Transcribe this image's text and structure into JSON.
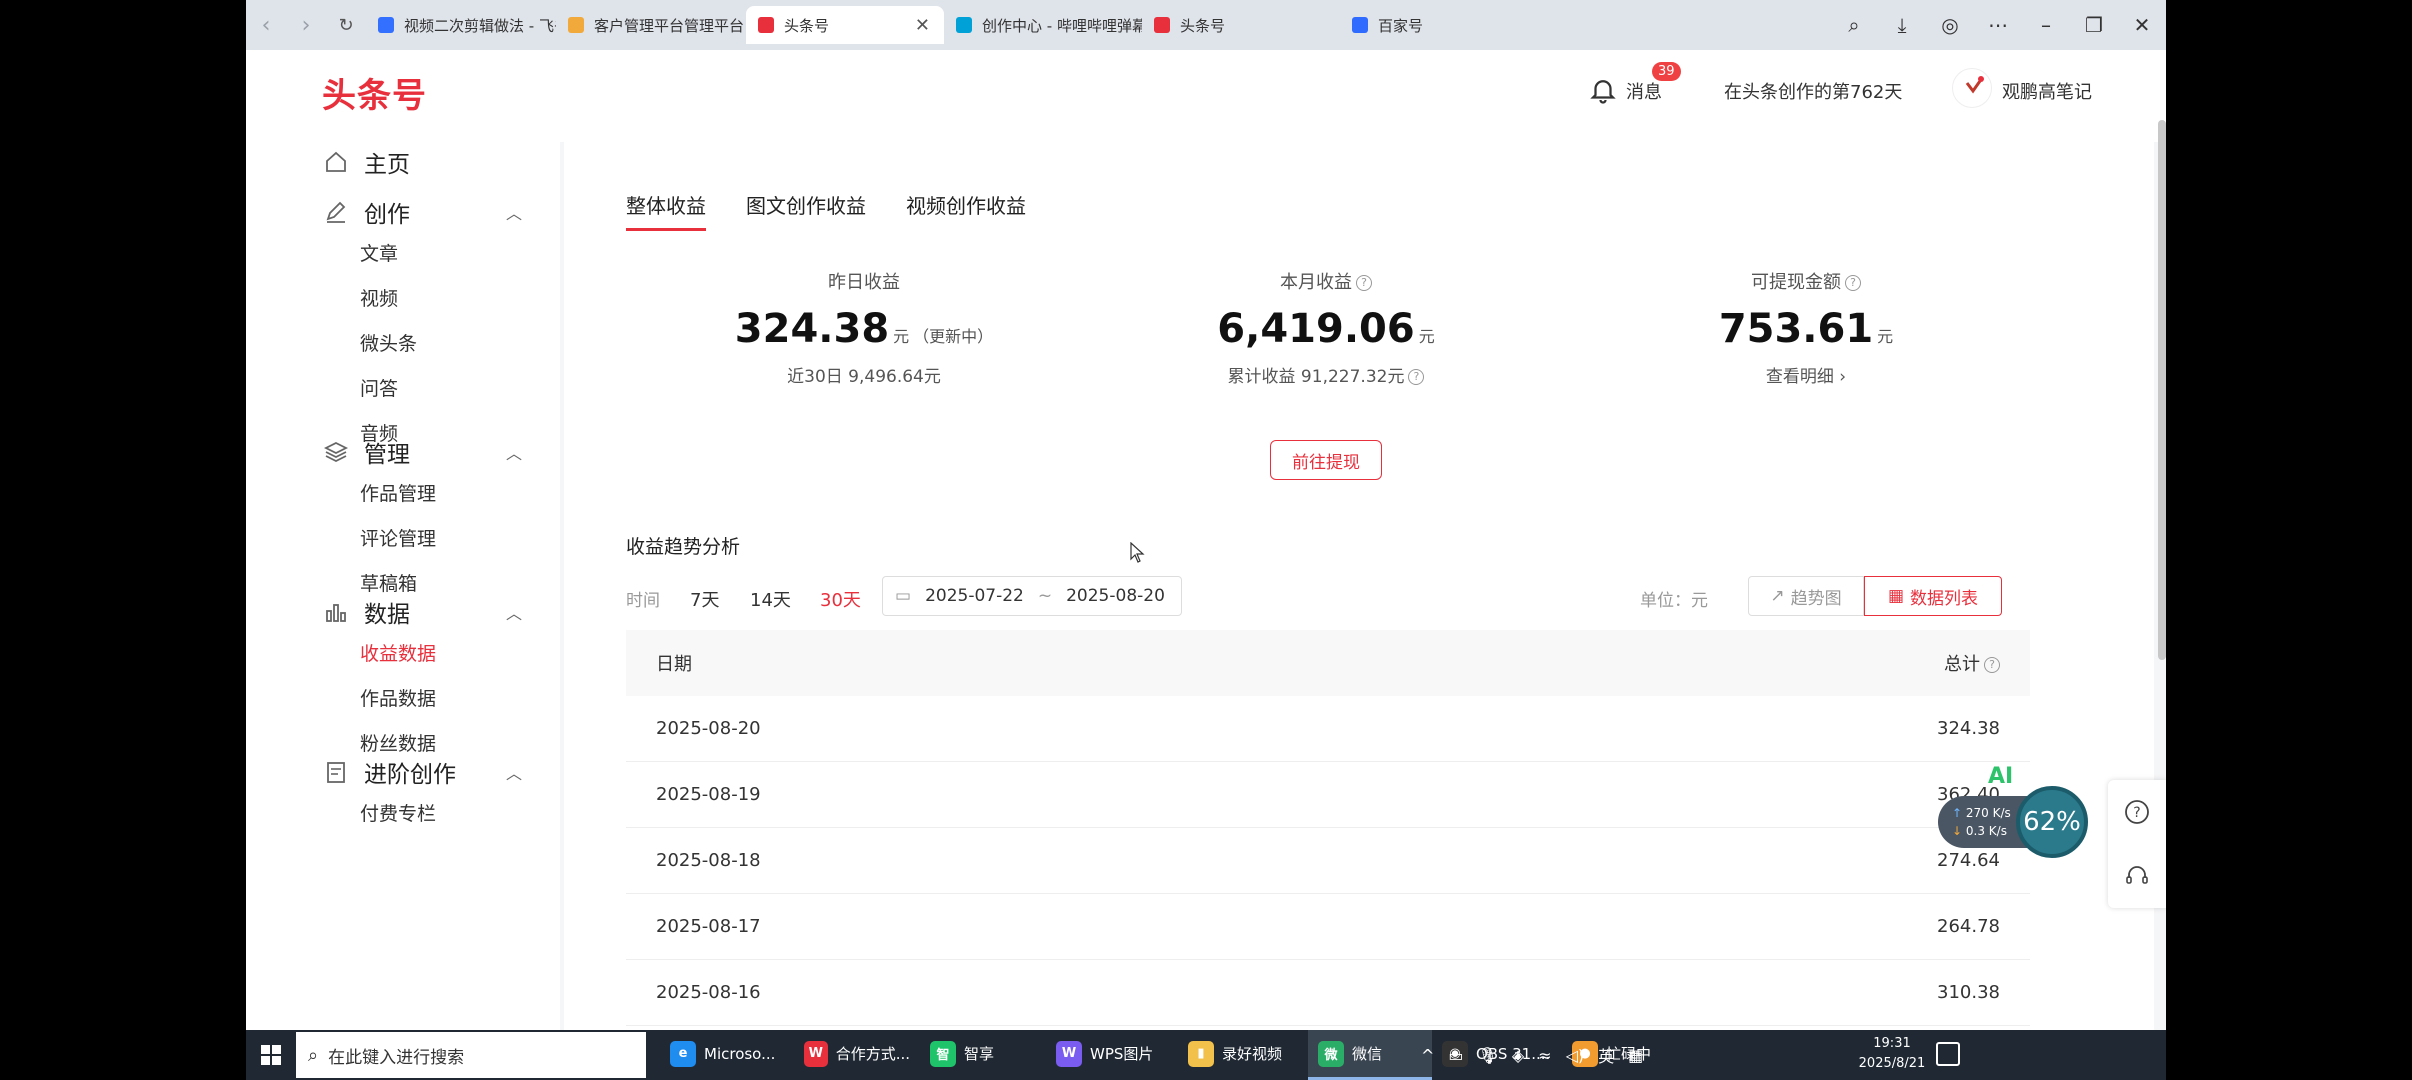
{
  "browser": {
    "tabs": [
      {
        "title": "视频二次剪辑做法 - 飞书云文",
        "active": false,
        "icon_color": "#3370ff"
      },
      {
        "title": "客户管理平台管理平台",
        "active": false,
        "icon_color": "#f2a93b"
      },
      {
        "title": "头条号",
        "active": true,
        "icon_color": "#e8303d"
      },
      {
        "title": "创作中心 - 哔哩哔哩弹幕视频",
        "active": false,
        "icon_color": "#00a1d6"
      },
      {
        "title": "头条号",
        "active": false,
        "icon_color": "#e8303d"
      },
      {
        "title": "百家号",
        "active": false,
        "icon_color": "#2f6bff"
      }
    ]
  },
  "header": {
    "logo": "头条号",
    "messages_label": "消息",
    "messages_badge": "39",
    "creation_days": "在头条创作的第762天",
    "username": "观鹏高笔记"
  },
  "sidebar": {
    "groups": [
      {
        "label": "主页",
        "icon": "home-icon",
        "items": []
      },
      {
        "label": "创作",
        "icon": "edit-icon",
        "items": [
          "文章",
          "视频",
          "微头条",
          "问答",
          "音频"
        ]
      },
      {
        "label": "管理",
        "icon": "layers-icon",
        "items": [
          "作品管理",
          "评论管理",
          "草稿箱"
        ]
      },
      {
        "label": "数据",
        "icon": "bar-chart-icon",
        "items": [
          "收益数据",
          "作品数据",
          "粉丝数据"
        ]
      },
      {
        "label": "进阶创作",
        "icon": "notes-icon",
        "items": [
          "付费专栏"
        ]
      }
    ],
    "active_item": "收益数据"
  },
  "content": {
    "tabs": [
      "整体收益",
      "图文创作收益",
      "视频创作收益"
    ],
    "active_tab": "整体收益",
    "stats": {
      "yesterday": {
        "title": "昨日收益",
        "value": "324.38",
        "unit": "元",
        "note": "（更新中）",
        "foot": "近30日 9,496.64元"
      },
      "month": {
        "title": "本月收益",
        "value": "6,419.06",
        "unit": "元",
        "foot": "累计收益 91,227.32元"
      },
      "withdrawable": {
        "title": "可提现金额",
        "value": "753.61",
        "unit": "元",
        "foot": "查看明细 ›"
      }
    },
    "withdraw_button": "前往提现",
    "trend": {
      "title": "收益趋势分析",
      "time_label": "时间",
      "ranges": [
        "7天",
        "14天",
        "30天"
      ],
      "active_range": "30天",
      "date_start": "2025-07-22",
      "date_end": "2025-08-20",
      "date_sep": "~",
      "unit_label": "单位：元",
      "btn_trend": "趋势图",
      "btn_table": "数据列表"
    },
    "table": {
      "col_date": "日期",
      "col_total": "总计",
      "rows": [
        {
          "date": "2025-08-20",
          "total": "324.38"
        },
        {
          "date": "2025-08-19",
          "total": "362.40"
        },
        {
          "date": "2025-08-18",
          "total": "274.64"
        },
        {
          "date": "2025-08-17",
          "total": "264.78"
        },
        {
          "date": "2025-08-16",
          "total": "310.38"
        }
      ]
    }
  },
  "overlay": {
    "ai_badge": "AI",
    "net_up": "270 K/s",
    "net_down": "0.3 K/s",
    "net_percent": "62%"
  },
  "taskbar": {
    "search_placeholder": "在此键入进行搜索",
    "apps": [
      {
        "label": "Microso...",
        "color": "#1f8cf0",
        "glyph": "e"
      },
      {
        "label": "合作方式...",
        "color": "#e8303d",
        "glyph": "W"
      },
      {
        "label": "智享",
        "color": "#1ec36a",
        "glyph": "智"
      },
      {
        "label": "WPS图片",
        "color": "#7a5cf0",
        "glyph": "W"
      },
      {
        "label": "录好视频",
        "color": "#f2c14b",
        "glyph": "▮"
      },
      {
        "label": "微信",
        "color": "#2aae67",
        "glyph": "微",
        "active": true
      },
      {
        "label": "OBS 31....",
        "color": "#333",
        "glyph": "◉"
      },
      {
        "label": "忙碌中",
        "color": "#f29b2e",
        "glyph": "●"
      }
    ],
    "ime": "英",
    "time": "19:31",
    "date": "2025/8/21"
  }
}
